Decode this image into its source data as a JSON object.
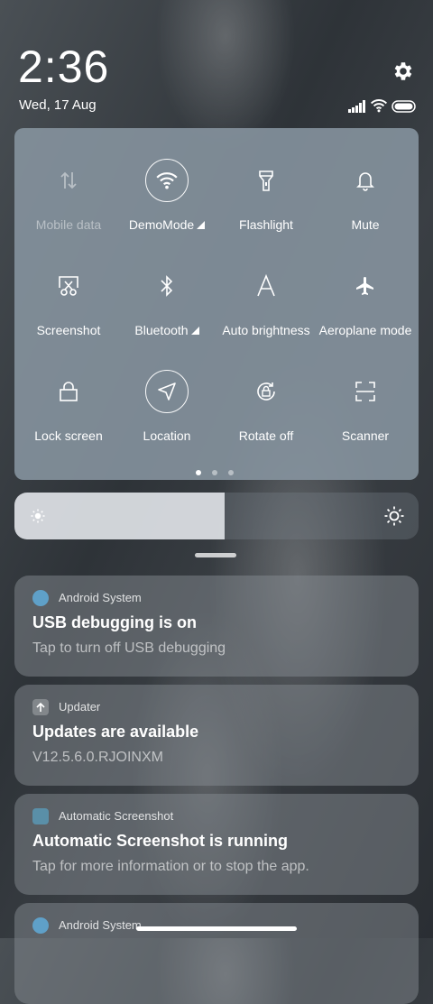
{
  "status": {
    "time": "2:36",
    "date": "Wed, 17 Aug",
    "icons": [
      "gear-icon",
      "signal-icon",
      "wifi-icon",
      "battery-icon"
    ]
  },
  "quick_settings": {
    "tiles": [
      {
        "label": "Mobile data",
        "icon": "mobile-data-icon",
        "active": false,
        "disabled": true
      },
      {
        "label": "DemoMode",
        "icon": "wifi-icon",
        "active": true,
        "dropdown": true
      },
      {
        "label": "Flashlight",
        "icon": "flashlight-icon",
        "active": false
      },
      {
        "label": "Mute",
        "icon": "bell-icon",
        "active": false
      },
      {
        "label": "Screenshot",
        "icon": "screenshot-icon",
        "active": false
      },
      {
        "label": "Bluetooth",
        "icon": "bluetooth-icon",
        "active": false,
        "dropdown": true
      },
      {
        "label": "Auto brightness",
        "icon": "auto-brightness-icon",
        "active": false
      },
      {
        "label": "Aeroplane mode",
        "icon": "aeroplane-icon",
        "active": false
      },
      {
        "label": "Lock screen",
        "icon": "lock-icon",
        "active": false
      },
      {
        "label": "Location",
        "icon": "location-icon",
        "active": true
      },
      {
        "label": "Rotate off",
        "icon": "rotate-lock-icon",
        "active": false
      },
      {
        "label": "Scanner",
        "icon": "scanner-icon",
        "active": false
      }
    ],
    "page_count": 3,
    "current_page": 1
  },
  "brightness": {
    "level": 0.52,
    "icons": [
      "sun-low-icon",
      "sun-high-icon"
    ]
  },
  "notifications": [
    {
      "app": "Android System",
      "title": "USB debugging is on",
      "text": "Tap to turn off USB debugging",
      "icon": "android-system-icon"
    },
    {
      "app": "Updater",
      "title": "Updates are available",
      "text": "V12.5.6.0.RJOINXM",
      "icon": "updater-icon"
    },
    {
      "app": "Automatic Screenshot",
      "title": "Automatic Screenshot is running",
      "text": "Tap for more information or to stop the app.",
      "icon": "screenshot-app-icon"
    },
    {
      "app": "Android System",
      "icon": "android-system-icon"
    }
  ]
}
